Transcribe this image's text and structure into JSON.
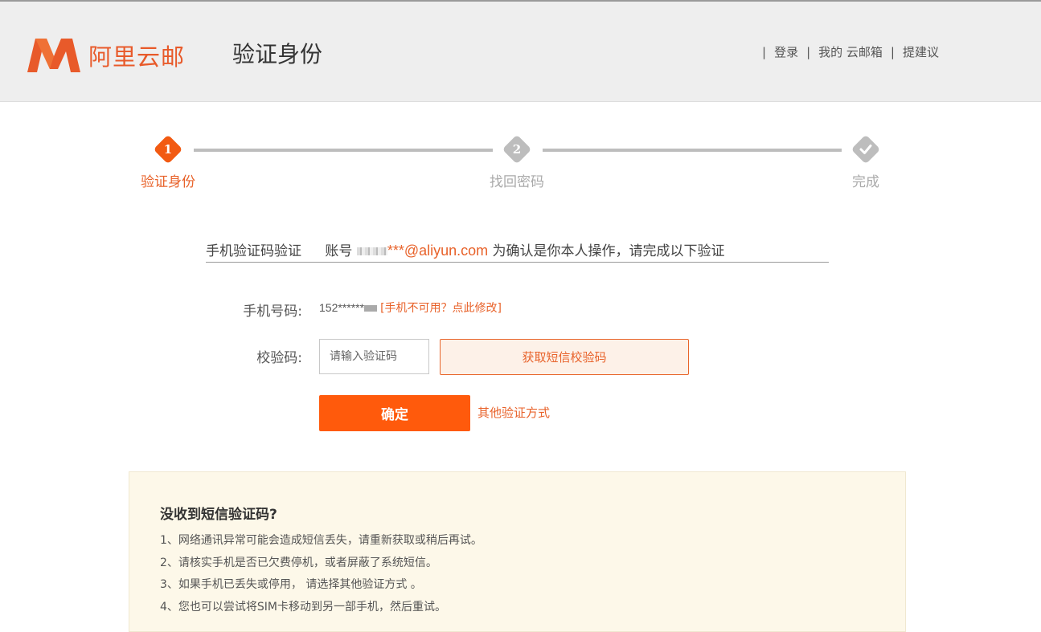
{
  "header": {
    "logo_text": "阿里云邮",
    "page_title": "验证身份",
    "nav": {
      "login": "登录",
      "my_mailbox": "我的 云邮箱",
      "suggest": "提建议"
    },
    "brand_color": "#e85a2a"
  },
  "steps": [
    {
      "num": "1",
      "label": "验证身份",
      "state": "active"
    },
    {
      "num": "2",
      "label": "找回密码",
      "state": "pending"
    },
    {
      "num": "",
      "label": "完成",
      "state": "pending",
      "icon": "check-icon"
    }
  ],
  "verify": {
    "method_label": "手机验证码验证",
    "account_prefix": "账号",
    "email": "***@aliyun.com",
    "account_suffix": "为确认是你本人操作，请完成以下验证"
  },
  "form": {
    "phone_label": "手机号码:",
    "phone_value": "152******",
    "change_phone_link": "[手机不可用？点此修改]",
    "code_label": "校验码:",
    "code_placeholder": "请输入验证码",
    "code_value": "",
    "get_sms_button": "获取短信校验码",
    "confirm_button": "确定",
    "other_methods_link": "其他验证方式"
  },
  "help": {
    "title": "没收到短信验证码?",
    "items": [
      "1、网络通讯异常可能会造成短信丢失，请重新获取或稍后再试。",
      "2、请核实手机是否已欠费停机，或者屏蔽了系统短信。",
      "3、如果手机已丢失或停用， 请选择其他验证方式 。",
      "4、您也可以尝试将SIM卡移动到另一部手机，然后重试。"
    ]
  },
  "colors": {
    "accent": "#ff5a0c",
    "active_step": "#f25a12",
    "inactive_step": "#bdbdbd",
    "help_bg": "#fdf8e9"
  }
}
